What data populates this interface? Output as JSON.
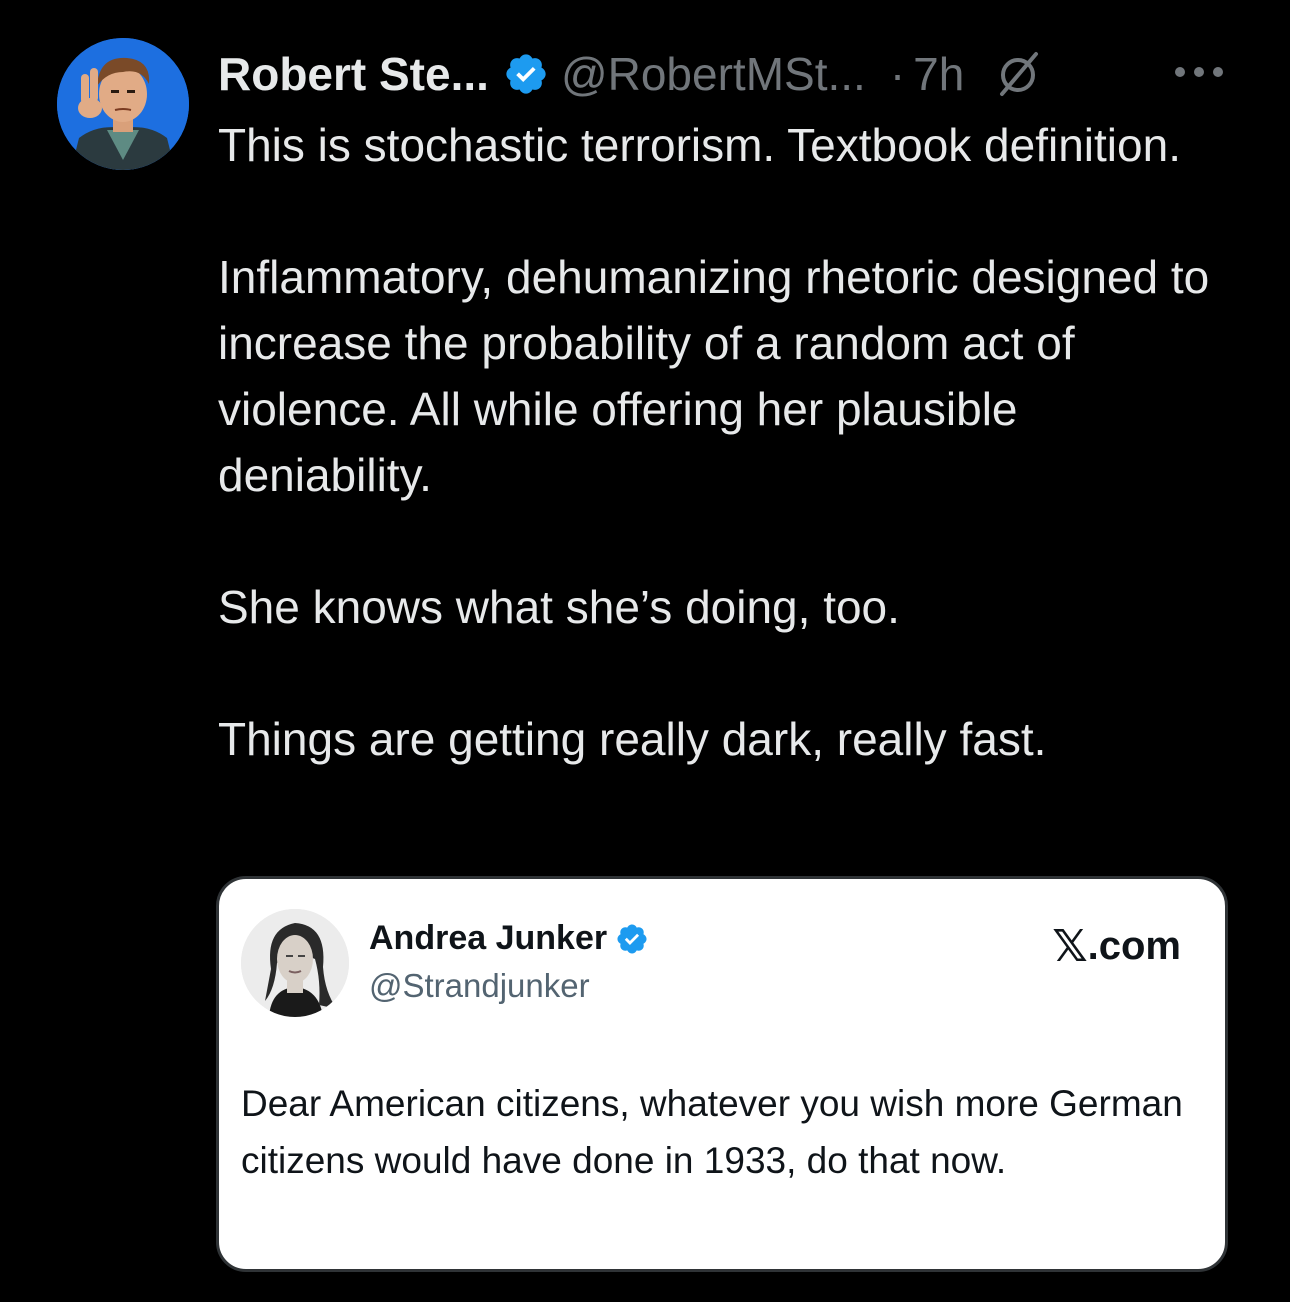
{
  "post": {
    "author_name": "Robert Ste...",
    "handle": "@RobertMSt...",
    "separator": "·",
    "time": "7h",
    "paragraphs": [
      "This is stochastic terrorism. Textbook definition.",
      "Inflammatory, dehumanizing rhetoric designed to increase the probability of a random act of violence. All while offering her plausible deniability.",
      "She knows what she’s doing, too.",
      "Things are getting really dark, really fast."
    ],
    "icons": {
      "avatar": "cartoon-man-avatar",
      "verified": "verified-badge-icon",
      "grok": "grok-icon",
      "more": "more-options-icon"
    }
  },
  "quoted_image": {
    "name": "Andrea Junker",
    "handle": "@Strandjunker",
    "source_mark": "𝕏",
    "source_domain": ".com",
    "text": "Dear American citizens, whatever you wish more German citizens would have done in 1933, do that now."
  },
  "colors": {
    "background": "#000000",
    "primary_text": "#e7e9ea",
    "secondary_text": "#71767b",
    "verified_blue": "#1d9bf0",
    "card_background": "#ffffff"
  }
}
